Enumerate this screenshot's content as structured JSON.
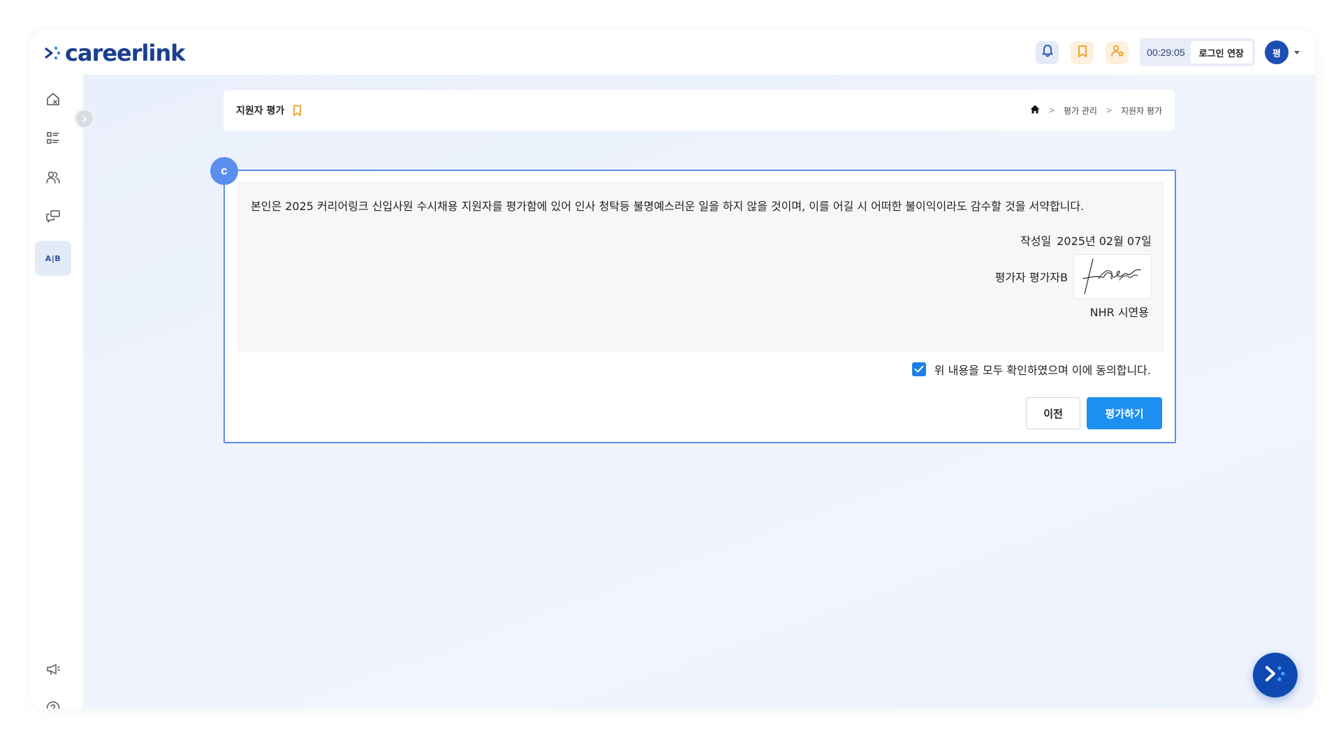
{
  "app": {
    "logo_text": "careerlink",
    "brand_color": "#1b3f8f",
    "accent_color": "#1d8ff0"
  },
  "topbar": {
    "icons": [
      "bell-icon",
      "bookmark-icon",
      "user-star-icon"
    ],
    "session_timer": "00:29:05",
    "extend_label": "로그인 연장",
    "avatar_initial": "평"
  },
  "sidebar": {
    "items": [
      {
        "name": "home-icon"
      },
      {
        "name": "list-icon"
      },
      {
        "name": "users-icon"
      },
      {
        "name": "chat-icon"
      },
      {
        "name": "ab-icon",
        "label": "A|B",
        "active": true
      }
    ],
    "bottom_items": [
      {
        "name": "megaphone-icon"
      },
      {
        "name": "help-icon"
      }
    ]
  },
  "header": {
    "title": "지원자 평가",
    "breadcrumb": [
      "평가 관리",
      "지원자 평가"
    ]
  },
  "step_badge": "c",
  "pledge": {
    "text": "본인은 2025 커리어링크 신입사원 수시채용  지원자를 평가함에 있어 인사 청탁등 불명예스러운 일을 하지 않을 것이며, 이를 어길 시 어떠한 불이익이라도 감수할 것을 서약합니다.",
    "date_label": "작성일",
    "date_value": "2025년 02월 07일",
    "evaluator_label": "평가자 평가자B",
    "organization": "NHR 시연용"
  },
  "agreement": {
    "checked": true,
    "text": "위 내용을 모두 확인하였으며 이에 동의합니다."
  },
  "buttons": {
    "prev": "이전",
    "evaluate": "평가하기"
  }
}
